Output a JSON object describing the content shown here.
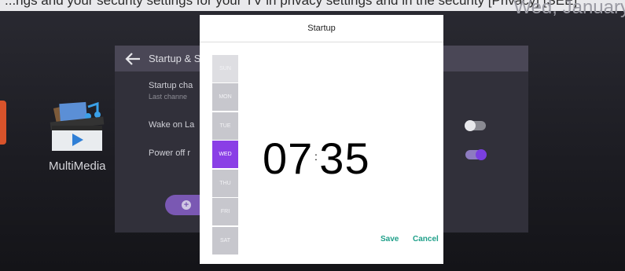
{
  "background": {
    "ticker_text": "...ngs and your security settings for your TV in privacy settings and in the security [Privacy] [SEE]",
    "datetime": "Wed, January"
  },
  "apps": [
    {
      "label": "MultiMedia",
      "icon": "multimedia-icon"
    }
  ],
  "settings": {
    "title": "Startup & Sh",
    "rows": [
      {
        "title": "Startup cha",
        "subtitle": "Last channe"
      },
      {
        "title": "Wake on La",
        "toggle": "off"
      },
      {
        "title": "Power off r",
        "toggle": "on"
      }
    ],
    "add_label": "A"
  },
  "dialog": {
    "title": "Startup",
    "days": [
      {
        "label": "SUN",
        "active": false
      },
      {
        "label": "MON",
        "active": false
      },
      {
        "label": "TUE",
        "active": false
      },
      {
        "label": "WED",
        "active": true
      },
      {
        "label": "THU",
        "active": false
      },
      {
        "label": "FRI",
        "active": false
      },
      {
        "label": "SAT",
        "active": false
      }
    ],
    "time_hours": "07",
    "time_colon": ":",
    "time_minutes": "35",
    "save_label": "Save",
    "cancel_label": "Cancel"
  },
  "colors": {
    "accent": "#8a3fe6",
    "action": "#20a08a",
    "panel": "#31303a"
  }
}
